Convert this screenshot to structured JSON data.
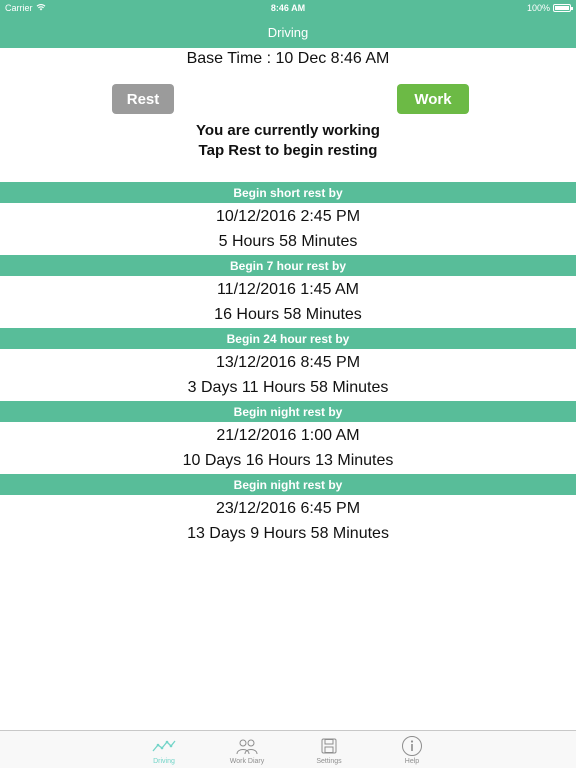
{
  "status_bar": {
    "carrier": "Carrier",
    "time": "8:46 AM",
    "battery": "100%",
    "wifi_icon": "wifi-icon",
    "battery_icon": "battery-icon"
  },
  "navbar": {
    "title": "Driving"
  },
  "base_time": "Base Time : 10 Dec 8:46 AM",
  "buttons": {
    "rest": "Rest",
    "work": "Work"
  },
  "state": {
    "line1": "You are currently working",
    "line2": "Tap Rest to begin resting"
  },
  "sections": [
    {
      "header": "Begin short rest by",
      "date": "10/12/2016 2:45 PM",
      "duration": "5 Hours 58 Minutes"
    },
    {
      "header": "Begin 7 hour rest by",
      "date": "11/12/2016 1:45 AM",
      "duration": "16 Hours 58 Minutes"
    },
    {
      "header": "Begin 24 hour rest by",
      "date": "13/12/2016 8:45 PM",
      "duration": "3 Days 11 Hours 58 Minutes"
    },
    {
      "header": "Begin night rest by",
      "date": "21/12/2016 1:00 AM",
      "duration": "10 Days 16 Hours 13 Minutes"
    },
    {
      "header": "Begin night rest by",
      "date": "23/12/2016 6:45 PM",
      "duration": "13 Days 9 Hours 58 Minutes"
    }
  ],
  "tabbar": {
    "tabs": [
      {
        "label": "Driving",
        "icon": "line-chart-icon",
        "active": true
      },
      {
        "label": "Work Diary",
        "icon": "people-icon",
        "active": false
      },
      {
        "label": "Settings",
        "icon": "floppy-disk-icon",
        "active": false
      },
      {
        "label": "Help",
        "icon": "info-icon",
        "active": false
      }
    ]
  },
  "colors": {
    "header_teal": "#58bd99",
    "rest_button": "#9b9b9b",
    "work_button": "#6cba45",
    "active_tab": "#72d4c8"
  }
}
